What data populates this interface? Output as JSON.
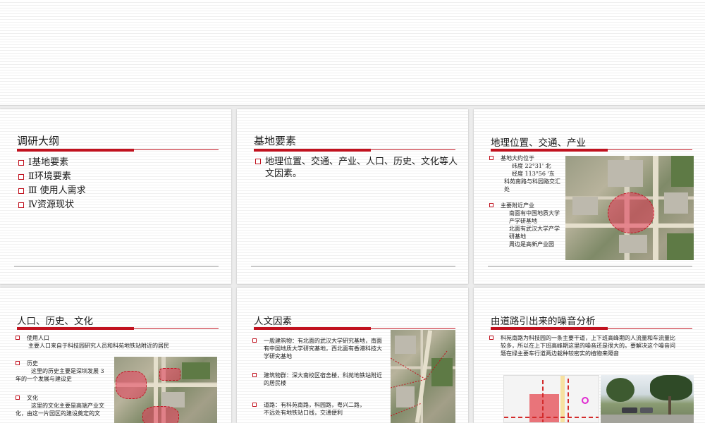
{
  "slides": {
    "s1": {
      "title": "调研大纲",
      "items": [
        "Ⅰ基地要素",
        "Ⅱ环境要素",
        "Ⅲ 使用人需求",
        "Ⅳ资源现状"
      ]
    },
    "s2": {
      "title": "基地要素",
      "item": "地理位置、交通、产业、人口、历史、文化等人文因素。"
    },
    "s3": {
      "title": "地理位置、交通、产业",
      "b1_head": "基地大约位于",
      "b1_lines": [
        "纬度 22°31' 北",
        "经度 113°56 '东",
        "科苑南路与科园路交汇处"
      ],
      "b2_head": "主要附近产业",
      "b2_lines": [
        "南面有中国地质大学产学研基地",
        "北面有武汉大学产学研基地",
        "周边是高新产业园"
      ]
    },
    "s4": {
      "title": "人口、历史、文化",
      "b1_head": "使用人口",
      "b1_text": "主要人口来自于科技园研究人员和科苑地铁站附近的居民",
      "b2_head": "历史",
      "b2_text1": "这里的历史主要是深圳发展 3",
      "b2_text2": "年的一个发展与建设史",
      "b3_head": "文化",
      "b3_text1": "这里的文化主要是高端产业文",
      "b3_text2": "化，由这一片园区的建设奠定的文"
    },
    "s5": {
      "title": "人文因素",
      "b1": "一般建筑物：有北面的武汉大学研究基地，南面有中国地质大学研究基地，西北面有香港科技大学研究基地",
      "b2": "建筑物群：深大南校区宿舍楼，科苑地铁站附近的居民楼",
      "b3a": "道路：有科苑南路，科园路，粤兴二路，",
      "b3b": "不远处有地铁站口线，交通便利"
    },
    "s6": {
      "title": "由道路引出来的噪音分析",
      "b1": "科苑南路为科技园的一条主要干道，上下班高峰期的人流量和车流量比较多，所以在上下班高峰期这里的噪音还是很大的。要解决这个噪音问题在绿主要车行道两边栽种较密实的植物来隔音"
    }
  },
  "colors": {
    "accent": "#c1121f",
    "text": "#1b1b1b"
  }
}
